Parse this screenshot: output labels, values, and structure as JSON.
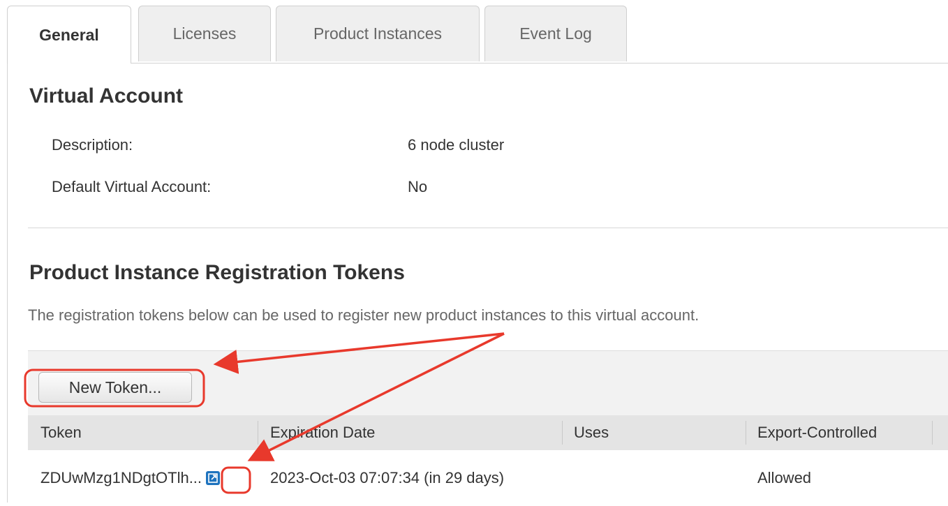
{
  "tabs": [
    {
      "label": "General",
      "active": true
    },
    {
      "label": "Licenses",
      "active": false
    },
    {
      "label": "Product Instances",
      "active": false
    },
    {
      "label": "Event Log",
      "active": false
    }
  ],
  "virtual_account": {
    "title": "Virtual Account",
    "description_label": "Description:",
    "description_value": "6 node cluster",
    "default_label": "Default Virtual Account:",
    "default_value": "No"
  },
  "tokens_section": {
    "title": "Product Instance Registration Tokens",
    "intro": "The registration tokens below can be used to register new product instances to this virtual account.",
    "new_token_button": "New Token..."
  },
  "table": {
    "headers": [
      "Token",
      "Expiration Date",
      "Uses",
      "Export-Controlled"
    ],
    "rows": [
      {
        "token": "ZDUwMzg1NDgtOTlh...",
        "expiration": "2023-Oct-03 07:07:34 (in 29 days)",
        "uses": "",
        "export_controlled": "Allowed",
        "copy_icon": "copy-link-icon"
      }
    ]
  },
  "colors": {
    "annotation_red": "#e8392c",
    "icon_blue": "#1e73be",
    "tab_inactive_bg": "#efefef",
    "toolbar_bg": "#f2f2f2",
    "header_bg": "#e4e4e4"
  }
}
